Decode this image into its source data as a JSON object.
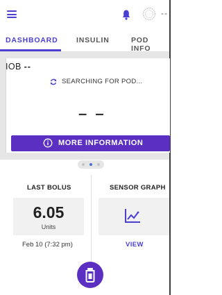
{
  "tabs": [
    {
      "label": "DASHBOARD",
      "active": true
    },
    {
      "label": "INSULIN",
      "active": false
    },
    {
      "label": "POD INFO",
      "active": false
    }
  ],
  "header": {
    "status_text": "--",
    "icons": [
      "menu-icon",
      "bell-icon",
      "pod-status-icon"
    ]
  },
  "iob": {
    "label": "IOB",
    "value": "--"
  },
  "pod_status": {
    "message": "SEARCHING FOR POD...",
    "reading": "– –",
    "icon": "sync-icon"
  },
  "more_info": {
    "label": "MORE INFORMATION",
    "icon": "info-icon"
  },
  "pager": {
    "pages": 3,
    "active_index": 1
  },
  "last_bolus": {
    "title": "LAST BOLUS",
    "value": "6.05",
    "units": "Units",
    "date": "Feb 10 (7:32 pm)"
  },
  "sensor_graph": {
    "title": "SENSOR GRAPH",
    "view_label": "VIEW",
    "icon": "trend-graph-icon"
  },
  "bolus_button": {
    "icon": "bolus-pod-icon"
  },
  "colors": {
    "accent": "#4a3fd0",
    "button": "#5b2fc2",
    "panel": "#e6e6e6"
  }
}
